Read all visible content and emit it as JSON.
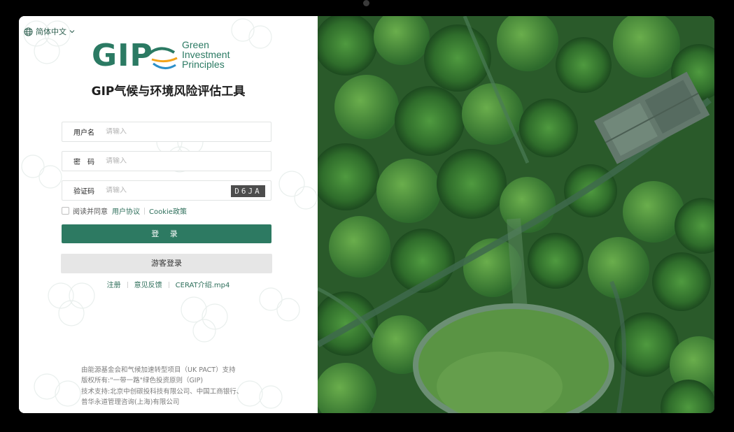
{
  "language": {
    "label": "简体中文"
  },
  "logo": {
    "mark": "GIP",
    "words": [
      "Green",
      "Investment",
      "Principles"
    ]
  },
  "app_title": "GIP气候与环境风险评估工具",
  "form": {
    "username": {
      "label": "用户名",
      "placeholder": "请输入"
    },
    "password": {
      "label": "密　码",
      "placeholder": "请输入"
    },
    "captcha": {
      "label": "验证码",
      "placeholder": "请输入",
      "code": "D6JA"
    },
    "agree": {
      "text": "阅读并同意",
      "user_agreement": "用户协议",
      "cookie_policy": "Cookie政策"
    },
    "login_button": "登 录",
    "guest_button": "游客登录"
  },
  "links": {
    "register": "注册",
    "feedback": "意见反馈",
    "video": "CERAT介绍.mp4"
  },
  "footer": {
    "line1": "由能源基金会和气候加速转型项目（UK PACT）支持",
    "line2": "版权所有:\"一带一路\"绿色投资原则（GIP)",
    "line3": "技术支持:北京中创碳投科技有限公司、中国工商银行、",
    "line4": "普华永道管理咨询(上海)有限公司"
  },
  "colors": {
    "brand_green": "#2d7a62",
    "guest_bg": "#e6e6e6",
    "link": "#2d6e5a"
  }
}
